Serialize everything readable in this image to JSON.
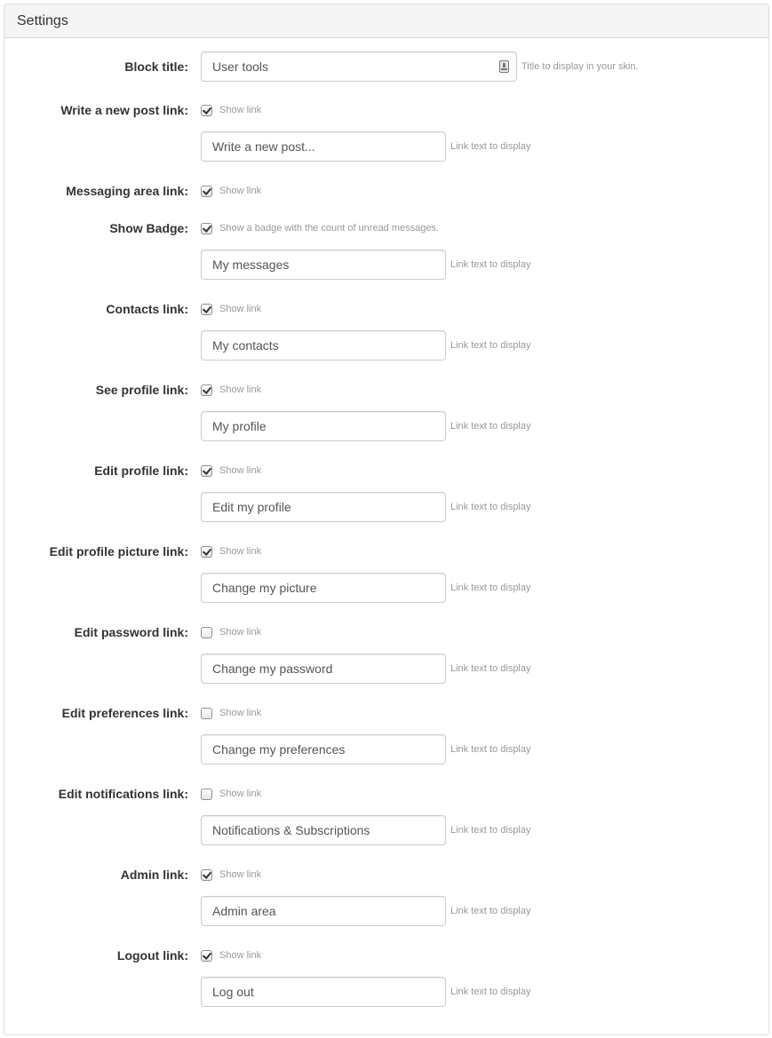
{
  "panel": {
    "title": "Settings"
  },
  "block_title": {
    "label": "Block title:",
    "value": "User tools",
    "hint": "Title to display in your skin.",
    "icon": "contact-card-icon"
  },
  "link_text_hint": "Link text to display",
  "show_link_label": "Show link",
  "fields": [
    {
      "id": "write-post",
      "label": "Write a new post link:",
      "checked": true,
      "checkbox_text": "Show link",
      "value": "Write a new post...",
      "hint": "Link text to display"
    },
    {
      "id": "messaging",
      "label": "Messaging area link:",
      "checked": true,
      "checkbox_text": "Show link"
    },
    {
      "id": "show-badge",
      "label": "Show Badge:",
      "checked": true,
      "checkbox_text": "Show a badge with the count of unread messages.",
      "value": "My messages",
      "hint": "Link text to display"
    },
    {
      "id": "contacts",
      "label": "Contacts link:",
      "checked": true,
      "checkbox_text": "Show link",
      "value": "My contacts",
      "hint": "Link text to display"
    },
    {
      "id": "see-profile",
      "label": "See profile link:",
      "checked": true,
      "checkbox_text": "Show link",
      "value": "My profile",
      "hint": "Link text to display"
    },
    {
      "id": "edit-profile",
      "label": "Edit profile link:",
      "checked": true,
      "checkbox_text": "Show link",
      "value": "Edit my profile",
      "hint": "Link text to display"
    },
    {
      "id": "edit-picture",
      "label": "Edit profile picture link:",
      "checked": true,
      "checkbox_text": "Show link",
      "value": "Change my picture",
      "hint": "Link text to display"
    },
    {
      "id": "edit-password",
      "label": "Edit password link:",
      "checked": false,
      "checkbox_text": "Show link",
      "value": "Change my password",
      "hint": "Link text to display"
    },
    {
      "id": "edit-preferences",
      "label": "Edit preferences link:",
      "checked": false,
      "checkbox_text": "Show link",
      "value": "Change my preferences",
      "hint": "Link text to display"
    },
    {
      "id": "edit-notifications",
      "label": "Edit notifications link:",
      "checked": false,
      "checkbox_text": "Show link",
      "value": "Notifications & Subscriptions",
      "hint": "Link text to display"
    },
    {
      "id": "admin",
      "label": "Admin link:",
      "checked": true,
      "checkbox_text": "Show link",
      "value": "Admin area",
      "hint": "Link text to display"
    },
    {
      "id": "logout",
      "label": "Logout link:",
      "checked": true,
      "checkbox_text": "Show link",
      "value": "Log out",
      "hint": "Link text to display"
    }
  ]
}
